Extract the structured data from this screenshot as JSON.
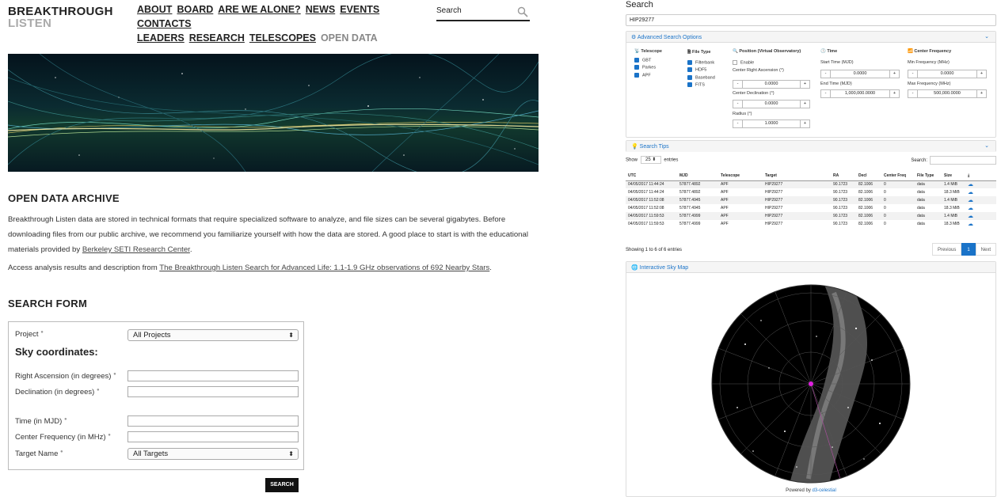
{
  "left": {
    "logo": {
      "line1": "BREAKTHROUGH",
      "line2": "LISTEN"
    },
    "nav": [
      "ABOUT",
      "BOARD",
      "ARE WE ALONE?",
      "NEWS",
      "EVENTS",
      "CONTACTS",
      "LEADERS",
      "RESEARCH",
      "TELESCOPES",
      "OPEN DATA"
    ],
    "nav_current": "OPEN DATA",
    "search_label": "Search",
    "archive_heading": "OPEN DATA ARCHIVE",
    "intro_text": "Breakthrough Listen data are stored in technical formats that require specialized software to analyze, and file sizes can be several gigabytes. Before downloading files from our public archive, we recommend you familiarize yourself with how the data are stored. A good place to start is with the educational materials provided by ",
    "intro_link": "Berkeley SETI Research Center",
    "intro_end": ".",
    "access_text": "Access analysis results and description from ",
    "access_link": "The Breakthrough Listen Search for Advanced Life: 1.1-1.9 GHz observations of 692 Nearby Stars",
    "access_end": ".",
    "form_heading": "SEARCH FORM",
    "form": {
      "project_label": "Project",
      "project_value": "All Projects",
      "sky_heading": "Sky coordinates:",
      "ra_label": "Right Ascension (in degrees)",
      "dec_label": "Declination (in degrees)",
      "time_label": "Time (in MJD)",
      "freq_label": "Center Frequency (in MHz)",
      "target_label": "Target Name",
      "target_value": "All Targets",
      "submit": "SEARCH"
    }
  },
  "right": {
    "title": "Search",
    "query": "HIP29277",
    "advanced_label": "Advanced Search Options",
    "telescope": {
      "heading": "Telescope",
      "items": [
        "GBT",
        "Parkes",
        "APF"
      ]
    },
    "filetype": {
      "heading": "File Type",
      "items": [
        "Filterbank",
        "HDF5",
        "Baseband",
        "FITS"
      ]
    },
    "position": {
      "heading": "Position (Virtual Observatory)",
      "enable": "Enable",
      "ra_label": "Center Right Ascension (°)",
      "ra_value": "0.0000",
      "dec_label": "Center Declination (°)",
      "dec_value": "0.0000",
      "radius_label": "Radius (°)",
      "radius_value": "1.0000"
    },
    "time": {
      "heading": "Time",
      "start_label": "Start Time (MJD)",
      "start_value": "0.0000",
      "end_label": "End Time (MJD)",
      "end_value": "1,000,000.0000"
    },
    "freq": {
      "heading": "Center Frequency",
      "min_label": "Min Frequency (MHz)",
      "min_value": "0.0000",
      "max_label": "Max Frequency (MHz)",
      "max_value": "500,000.0000"
    },
    "tips_label": "Search Tips",
    "show_label": "Show",
    "show_value": "25",
    "entries_label": "entries",
    "table_search_label": "Search:",
    "columns": [
      "UTC",
      "MJD",
      "Telescope",
      "Target",
      "RA",
      "Decl",
      "Center Freq",
      "File Type",
      "Size"
    ],
    "rows": [
      [
        "04/05/2017 11:44:24",
        "57877.4892",
        "APF",
        "HIP29277",
        "90.1723",
        "82.1006",
        "0",
        "data",
        "1.4 MiB"
      ],
      [
        "04/05/2017 11:44:24",
        "57877.4892",
        "APF",
        "HIP29277",
        "90.1723",
        "82.1006",
        "0",
        "data",
        "18.3 MiB"
      ],
      [
        "04/05/2017 11:52:08",
        "57877.4945",
        "APF",
        "HIP29277",
        "90.1723",
        "82.1006",
        "0",
        "data",
        "1.4 MiB"
      ],
      [
        "04/05/2017 11:52:08",
        "57877.4945",
        "APF",
        "HIP29277",
        "90.1723",
        "82.1006",
        "0",
        "data",
        "18.3 MiB"
      ],
      [
        "04/05/2017 11:59:53",
        "57877.4999",
        "APF",
        "HIP29277",
        "90.1723",
        "82.1006",
        "0",
        "data",
        "1.4 MiB"
      ],
      [
        "04/05/2017 11:59:53",
        "57877.4999",
        "APF",
        "HIP29277",
        "90.1723",
        "82.1006",
        "0",
        "data",
        "18.3 MiB"
      ]
    ],
    "info": "Showing 1 to 6 of 6 entries",
    "pager": {
      "prev": "Previous",
      "page": "1",
      "next": "Next"
    },
    "skymap_label": "Interactive Sky Map",
    "powered_by": "Powered by",
    "powered_link": "d3-celestial"
  }
}
